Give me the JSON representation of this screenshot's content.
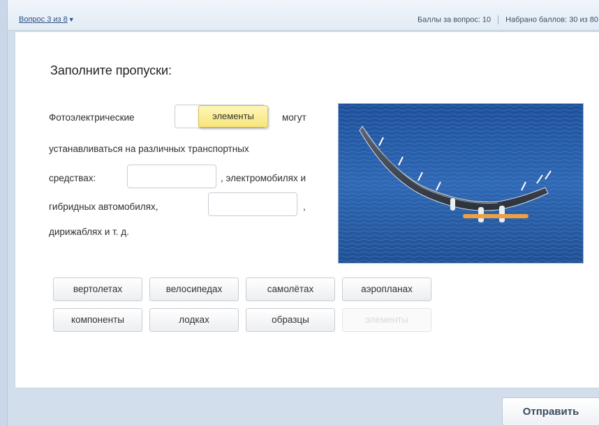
{
  "header": {
    "question_nav": "Вопрос 3 из 8",
    "points_per_question": "Баллы за вопрос: 10",
    "points_total": "Набрано баллов: 30 из 80"
  },
  "task": {
    "title": "Заполните пропуски:",
    "sentence_parts": [
      "Фотоэлектрические",
      "могут",
      "устанавливаться на различных транспортных",
      "средствах:",
      ", электромобилях и",
      "гибридных автомобилях,",
      ",",
      "дирижаблях и т. д."
    ],
    "dragged_word": "элементы"
  },
  "word_bank": [
    {
      "label": "вертолетах",
      "used": false
    },
    {
      "label": "велосипедах",
      "used": false
    },
    {
      "label": "самолётах",
      "used": false
    },
    {
      "label": "аэропланах",
      "used": false
    },
    {
      "label": "компоненты",
      "used": false
    },
    {
      "label": "лодках",
      "used": false
    },
    {
      "label": "образцы",
      "used": false
    },
    {
      "label": "элементы",
      "used": true
    }
  ],
  "image": {
    "subject": "solar-powered aircraft over sea"
  },
  "footer": {
    "submit_label": "Отправить"
  }
}
